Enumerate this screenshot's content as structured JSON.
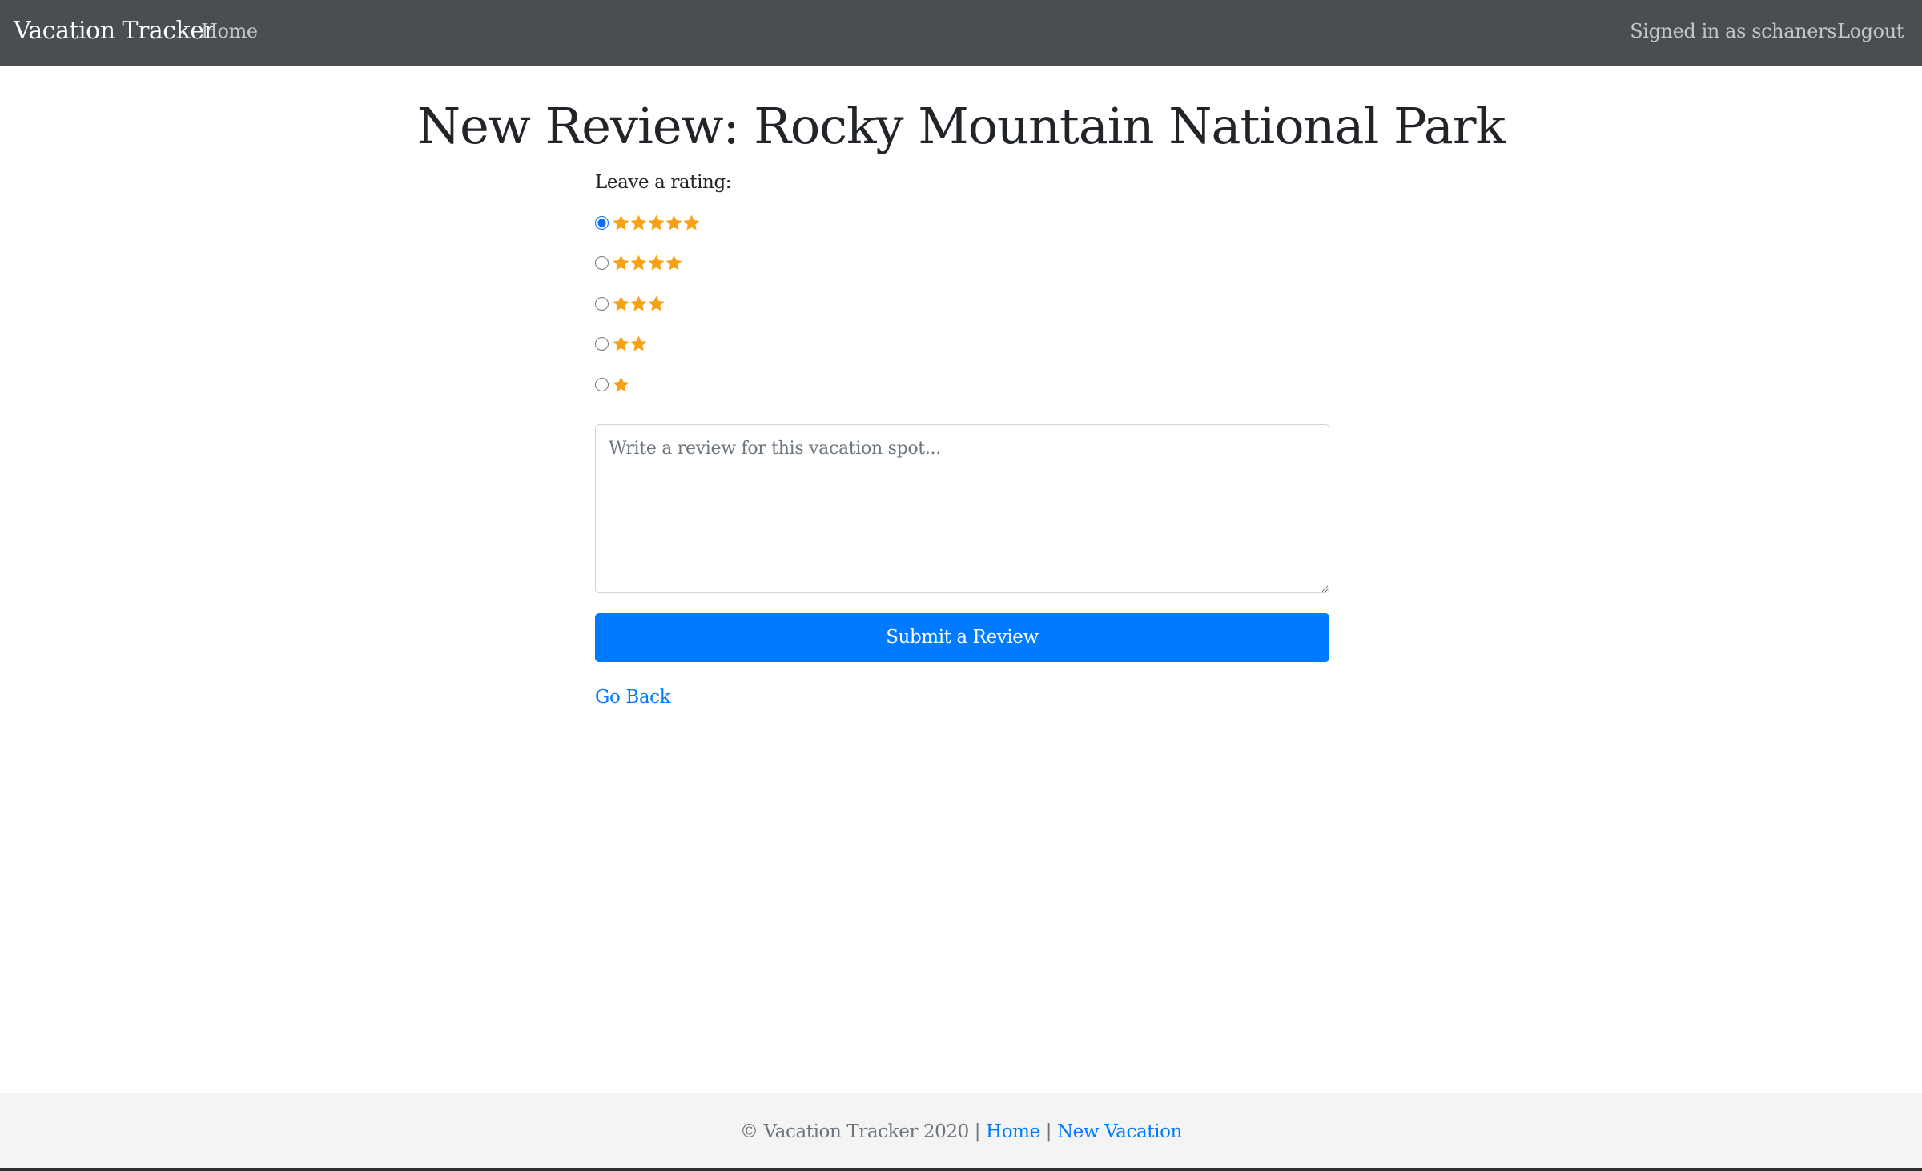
{
  "navbar": {
    "brand": "Vacation Tracker",
    "home_label": "Home",
    "signed_in_text": "Signed in as schaners",
    "logout_label": "Logout"
  },
  "main": {
    "title": "New Review: Rocky Mountain National Park",
    "rating_label": "Leave a rating:",
    "rating_options": [
      {
        "stars": 5,
        "selected": true
      },
      {
        "stars": 4,
        "selected": false
      },
      {
        "stars": 3,
        "selected": false
      },
      {
        "stars": 2,
        "selected": false
      },
      {
        "stars": 1,
        "selected": false
      }
    ],
    "review_placeholder": "Write a review for this vacation spot...",
    "review_value": "",
    "submit_label": "Submit a Review",
    "go_back_label": "Go Back"
  },
  "footer": {
    "copyright": "© Vacation Tracker 2020 |",
    "separator": "|",
    "home_link": "Home",
    "new_vacation_link": "New Vacation"
  },
  "colors": {
    "navbar_bg": "#4a4e52",
    "accent": "#007bff",
    "star": "#f7a116",
    "footer_bg": "#f4f4f4"
  },
  "icons": {
    "rating_star": "star-icon"
  }
}
